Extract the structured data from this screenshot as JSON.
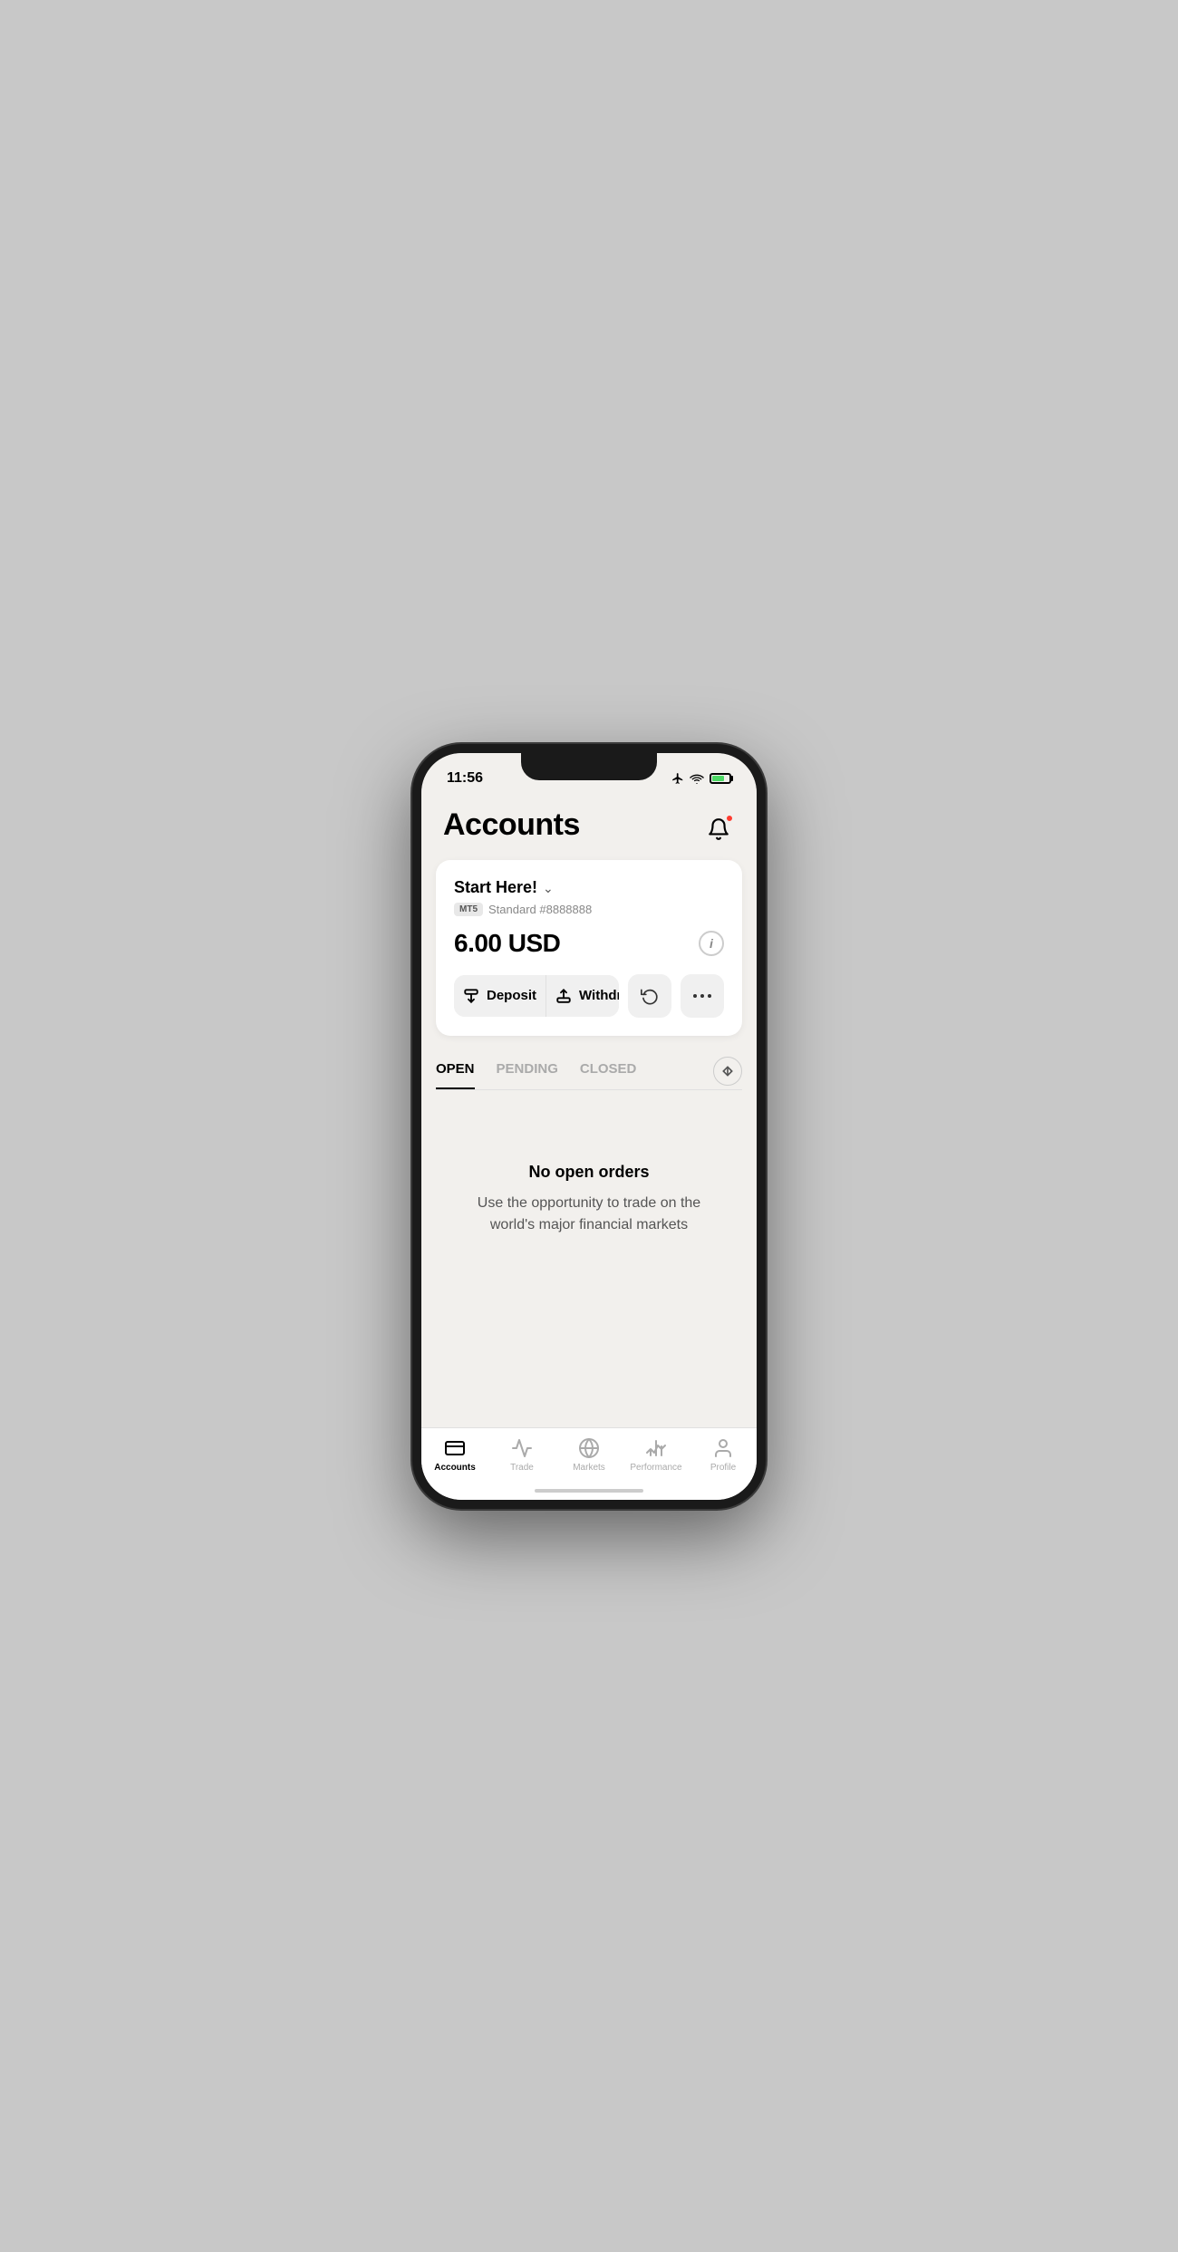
{
  "status_bar": {
    "time": "11:56"
  },
  "header": {
    "title": "Accounts",
    "bell_label": "notifications"
  },
  "account_card": {
    "account_name": "Start Here!",
    "badge": "MT5",
    "account_type": "Standard #8888888",
    "balance": "6.00 USD",
    "deposit_label": "Deposit",
    "withdraw_label": "Withdraw",
    "info_label": "i"
  },
  "tabs": {
    "open_label": "OPEN",
    "pending_label": "PENDING",
    "closed_label": "CLOSED",
    "active": "open"
  },
  "empty_state": {
    "title": "No open orders",
    "description": "Use the opportunity to trade on the world's major financial markets"
  },
  "bottom_nav": {
    "accounts_label": "Accounts",
    "trade_label": "Trade",
    "markets_label": "Markets",
    "performance_label": "Performance",
    "profile_label": "Profile"
  }
}
